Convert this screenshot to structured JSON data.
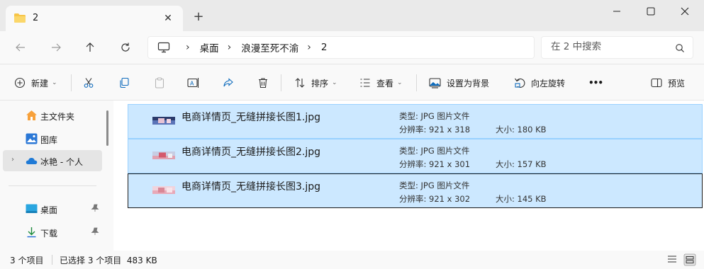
{
  "window": {
    "tab_title": "2",
    "new_tab_label": "+",
    "close_tab_label": "✕"
  },
  "address": {
    "crumbs": [
      "桌面",
      "浪漫至死不渝",
      "2"
    ],
    "search_placeholder": "在 2 中搜索"
  },
  "toolbar": {
    "new_label": "新建",
    "sort_label": "排序",
    "view_label": "查看",
    "set_background_label": "设置为背景",
    "rotate_left_label": "向左旋转",
    "more_label": "•••",
    "preview_label": "预览"
  },
  "sidebar": {
    "items": [
      {
        "label": "主文件夹",
        "icon": "home-icon"
      },
      {
        "label": "图库",
        "icon": "gallery-icon"
      },
      {
        "label": "冰艳 - 个人",
        "icon": "onedrive-icon"
      },
      {
        "label": "桌面",
        "icon": "desktop-icon"
      },
      {
        "label": "下载",
        "icon": "download-icon"
      }
    ]
  },
  "files": [
    {
      "name": "电商详情页_无缝拼接长图1.jpg",
      "type": "类型: JPG 图片文件",
      "resolution": "分辨率: 921 x 318",
      "size": "大小: 180 KB"
    },
    {
      "name": "电商详情页_无缝拼接长图2.jpg",
      "type": "类型: JPG 图片文件",
      "resolution": "分辨率: 921 x 301",
      "size": "大小: 157 KB"
    },
    {
      "name": "电商详情页_无缝拼接长图3.jpg",
      "type": "类型: JPG 图片文件",
      "resolution": "分辨率: 921 x 302",
      "size": "大小: 145 KB"
    }
  ],
  "status": {
    "item_count": "3 个项目",
    "selection": "已选择 3 个项目  483 KB"
  },
  "colors": {
    "selection_bg": "#cce8ff",
    "selection_border": "#99d1ff",
    "folder_yellow": "#f7c548",
    "accent_blue": "#0078d4"
  }
}
